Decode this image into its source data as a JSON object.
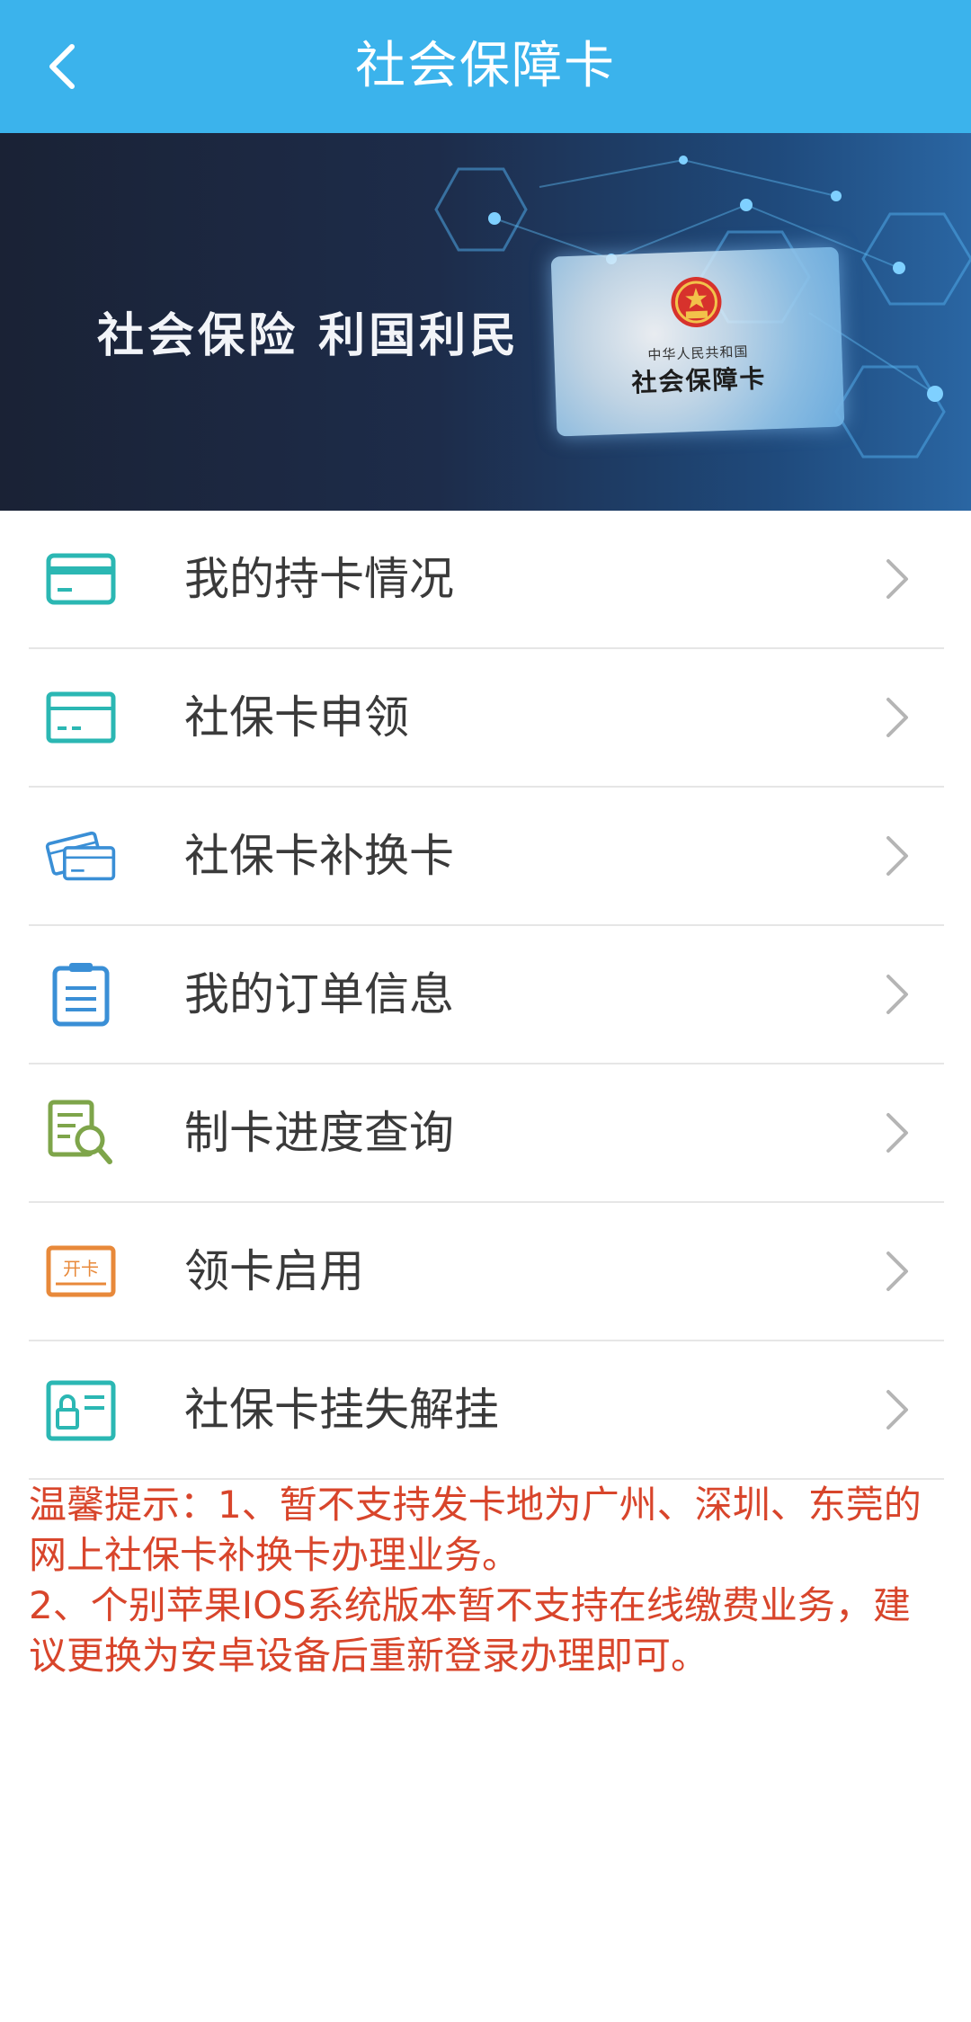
{
  "header": {
    "title": "社会保障卡",
    "back_icon": "back-arrow-icon"
  },
  "banner": {
    "slogan": "社会保险 利国利民",
    "card_country": "中华人民共和国",
    "card_name": "社会保障卡",
    "card_emblem_icon": "national-emblem-icon"
  },
  "menu": {
    "items": [
      {
        "label": "我的持卡情况",
        "icon": "card-icon",
        "color": "#2bb7b3"
      },
      {
        "label": "社保卡申领",
        "icon": "card-apply-icon",
        "color": "#2bb7b3"
      },
      {
        "label": "社保卡补换卡",
        "icon": "cards-replace-icon",
        "color": "#3a8fd6"
      },
      {
        "label": "我的订单信息",
        "icon": "clipboard-icon",
        "color": "#3a8fd6"
      },
      {
        "label": "制卡进度查询",
        "icon": "document-search-icon",
        "color": "#7ea54a"
      },
      {
        "label": "领卡启用",
        "icon": "card-activate-icon",
        "color": "#e8893a",
        "icon_text": "开卡"
      },
      {
        "label": "社保卡挂失解挂",
        "icon": "card-lock-icon",
        "color": "#2bb7b3"
      }
    ],
    "chevron_icon": "chevron-right-icon"
  },
  "notice": {
    "line1": "温馨提示：1、暂不支持发卡地为广州、深圳、东莞的网上社保卡补换卡办理业务。",
    "line2": "2、个别苹果IOS系统版本暂不支持在线缴费业务，建议更换为安卓设备后重新登录办理即可。",
    "color": "#d8452b"
  },
  "colors": {
    "accent": "#3bb3ec"
  }
}
